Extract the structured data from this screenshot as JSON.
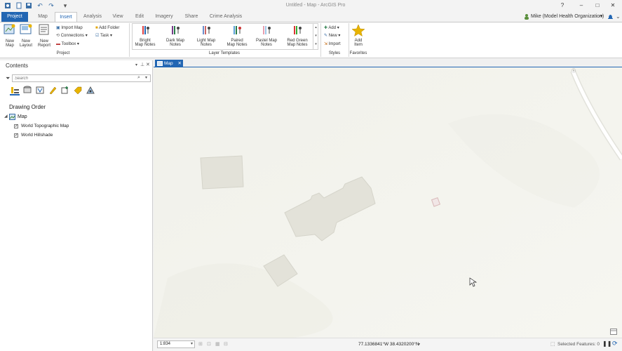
{
  "window": {
    "title": "Untitled - Map - ArcGIS Pro"
  },
  "tabs": [
    "Project",
    "Map",
    "Insert",
    "Analysis",
    "View",
    "Edit",
    "Imagery",
    "Share",
    "Crime Analysis"
  ],
  "user": {
    "name": "Mike (Model Health Organization)",
    "dropdown": "▾"
  },
  "window_controls": {
    "help": "?",
    "minimize": "–",
    "maximize": "□",
    "close": "✕"
  },
  "ribbon": {
    "project": {
      "group_label": "Project",
      "new_map": "New Map",
      "new_layout": "New Layout",
      "new_report": "New Report",
      "import_map": "Import Map",
      "connections": "Connections",
      "toolbox": "Toolbox",
      "add_folder": "Add Folder",
      "task": "Task"
    },
    "layer_templates": {
      "group_label": "Layer Templates",
      "items": [
        {
          "l1": "Bright",
          "l2": "Map Notes"
        },
        {
          "l1": "Dark Map",
          "l2": "Notes"
        },
        {
          "l1": "Light Map",
          "l2": "Notes"
        },
        {
          "l1": "Paired",
          "l2": "Map Notes"
        },
        {
          "l1": "Pastel Map",
          "l2": "Notes"
        },
        {
          "l1": "Red Green",
          "l2": "Map Notes"
        }
      ]
    },
    "styles": {
      "group_label": "Styles",
      "add": "Add",
      "new": "New",
      "import": "Import"
    },
    "favorites": {
      "group_label": "Favorites",
      "add_item_l1": "Add",
      "add_item_l2": "Item"
    }
  },
  "contents": {
    "title": "Contents",
    "pin": "ᛘ",
    "close": "✕",
    "search_placeholder": "Search",
    "drawing_order": "Drawing Order",
    "map_label": "Map",
    "layers": [
      {
        "name": "World Topographic Map",
        "checked": true
      },
      {
        "name": "World Hillshade",
        "checked": true
      }
    ]
  },
  "map_tab": {
    "label": "Map"
  },
  "status": {
    "scale": "1:834",
    "coords": "77.1336841°W 38.4320200°N",
    "selected_features": "Selected Features: 0"
  },
  "colors": {
    "accent": "#2266b3",
    "map_bg": "#f4f4ef",
    "building": "#e3e2d9"
  }
}
